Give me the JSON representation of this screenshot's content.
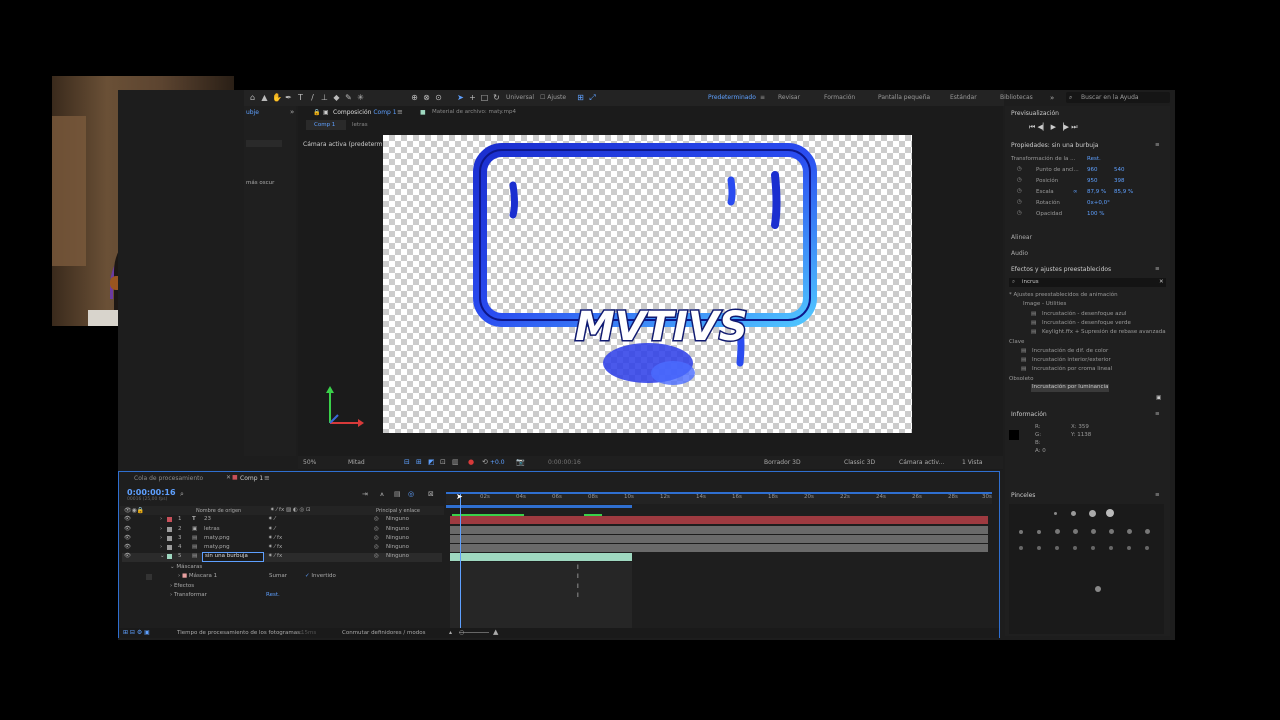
{
  "toolbar": {
    "universal": "Universal",
    "ajuste": "Ajuste",
    "workspaces": [
      "Predeterminado",
      "Revisar",
      "Formación",
      "Pantalla pequeña",
      "Estándar",
      "Bibliotecas"
    ],
    "search_placeholder": "Buscar en la Ayuda"
  },
  "project_panel": {
    "tab": "ubje",
    "field_value": "más oscur"
  },
  "composition": {
    "tab_label": "Composición",
    "comp_name": "Comp 1",
    "footage_tab": "Material de archivo: maty.mp4",
    "subtabs": [
      "Comp 1",
      "letras"
    ],
    "camera_label": "Cámara activa (predeterminad",
    "artwork_text": "MVTIVS",
    "zoom": "50%",
    "resolution": "Mitad",
    "plus_value": "+0.0",
    "timecode": "0:00:00:16",
    "renderer": "Borrador 3D",
    "renderer_mode": "Classic 3D",
    "view_camera": "Cámara activ...",
    "views": "1 Vista"
  },
  "preview": {
    "title": "Previsualización"
  },
  "properties": {
    "title": "Propiedades: sin una burbuja",
    "transform_label": "Transformación de la ...",
    "reset": "Rest.",
    "rows": [
      {
        "label": "Punto de ancl...",
        "v1": "960",
        "v2": "540"
      },
      {
        "label": "Posición",
        "v1": "950",
        "v2": "398"
      },
      {
        "label": "Escala",
        "v1": "87,9 %",
        "v2": "85,9 %"
      },
      {
        "label": "Rotación",
        "v1": "0x+0,0°",
        "v2": ""
      },
      {
        "label": "Opacidad",
        "v1": "100 %",
        "v2": ""
      }
    ],
    "align": "Alinear",
    "audio": "Audio"
  },
  "effects": {
    "title": "Efectos y ajustes preestablecidos",
    "search": "incrus",
    "items": [
      "* Ajustes preestablecidos de animación",
      "Image - Utilities",
      "Incrustación - desenfoque azul",
      "Incrustación - desenfoque verde",
      "Keylight.ffx + Supresión de rebase avanzada",
      "Clave",
      "Incrustación de dif. de color",
      "Incrustación interior/exterior",
      "Incrustación por croma lineal",
      "Obsoleto",
      "Incrustación por luminancia"
    ]
  },
  "info": {
    "title": "Información",
    "r": "R:",
    "g": "G:",
    "b": "B:",
    "a": "A: 0",
    "x": "X: 359",
    "y": "Y: 1138"
  },
  "brushes": {
    "title": "Pinceles"
  },
  "timeline": {
    "tabs": [
      "Cola de procesamiento",
      "Comp 1"
    ],
    "timecode": "0:00:00:16",
    "timecode_sub": "00016 (25,00 fps)",
    "col_name": "Nombre de origen",
    "col_parent": "Principal y enlace",
    "ticks": [
      "02s",
      "04s",
      "06s",
      "08s",
      "10s",
      "12s",
      "14s",
      "16s",
      "18s",
      "20s",
      "22s",
      "24s",
      "26s",
      "28s",
      "30s"
    ],
    "layers": [
      {
        "num": "1",
        "name": "23",
        "parent": "Ninguno",
        "color": "#c8505a"
      },
      {
        "num": "2",
        "name": "letras",
        "parent": "Ninguno",
        "color": "#9c9c9c"
      },
      {
        "num": "3",
        "name": "maty.png",
        "parent": "Ninguno",
        "color": "#9c9c9c"
      },
      {
        "num": "4",
        "name": "maty.png",
        "parent": "Ninguno",
        "color": "#9c9c9c"
      },
      {
        "num": "5",
        "name": "sin una burbuja",
        "parent": "Ninguno",
        "color": "#9fd8c0"
      }
    ],
    "sub_rows": {
      "masks": "Máscaras",
      "mask1": "Máscara 1",
      "mask_mode": "Sumar",
      "inverted": "Invertido",
      "effects": "Efectos",
      "transform": "Transformar",
      "reset": "Rest."
    },
    "footer": "Tiempo de procesamiento de los fotogramas:",
    "footer_value": "15ms",
    "toggle": "Conmutar definidores / modos"
  },
  "colors": {
    "accent": "#2f6fd0",
    "highlight": "#5ea0ff",
    "layer_red": "#9e3a40",
    "layer_teal": "#9fd8c0"
  }
}
